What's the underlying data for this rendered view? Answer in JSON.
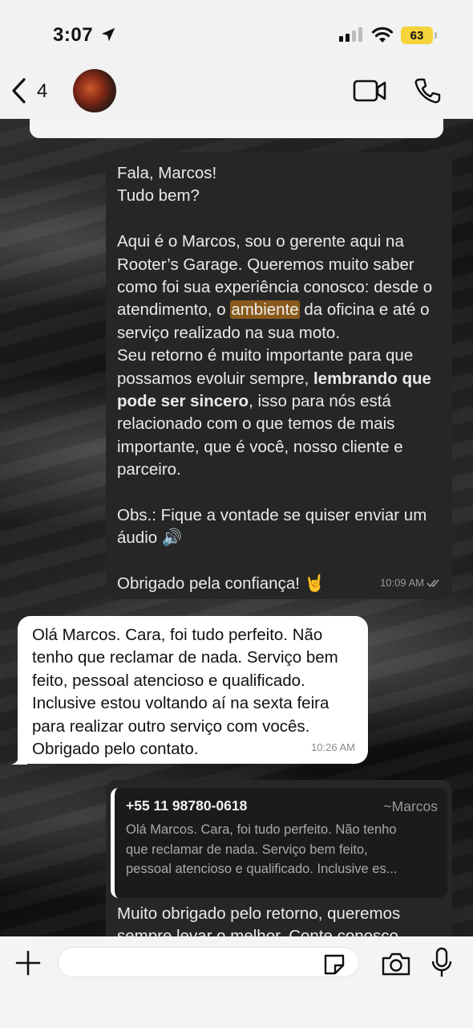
{
  "status_bar": {
    "time": "3:07",
    "battery": "63"
  },
  "header": {
    "back_count": "4"
  },
  "messages": {
    "msg1": {
      "line1": "Fala, Marcos!",
      "line2": "Tudo bem?",
      "p2_a": "Aqui é o Marcos, sou o gerente aqui na Rooter’s Garage. Queremos muito saber como foi sua experiência conosco: desde o atendimento, o ",
      "p2_highlight": "ambiente",
      "p2_b": " da oficina e até o serviço realizado na sua moto.",
      "p3_a": "Seu retorno é muito importante para que possamos evoluir sempre, ",
      "p3_bold": "lembrando que pode ser sincero",
      "p3_b": ", isso para nós está relacionado com o que temos de mais importante, que é você, nosso cliente e parceiro.",
      "p4": "Obs.: Fique a vontade se quiser enviar um áudio 🔊",
      "p5": "Obrigado pela confiança! 🤘",
      "time": "10:09 AM"
    },
    "msg2": {
      "text": "Olá Marcos. Cara, foi tudo perfeito. Não tenho que reclamar de nada. Serviço bem feito, pessoal atencioso e qualificado. Inclusive estou voltando aí na sexta feira para realizar outro serviço com vocês. Obrigado pelo contato.",
      "time": "10:26 AM"
    },
    "msg3": {
      "quote_phone": "+55 11 98780-0618",
      "quote_name": "~Marcos",
      "quote_line1": "Olá Marcos. Cara, foi tudo perfeito. Não tenho",
      "quote_line2": "que reclamar de nada. Serviço bem feito,",
      "quote_line3": "pessoal atencioso e qualificado. Inclusive es...",
      "text": "Muito obrigado pelo retorno, queremos sempre levar o melhor. Conte conosco"
    }
  },
  "composer": {
    "placeholder": ""
  },
  "colors": {
    "highlight": "#8a5a1c",
    "battery": "#f5d33a",
    "outgoing_bubble": "#262626",
    "incoming_bubble": "#ffffff"
  }
}
